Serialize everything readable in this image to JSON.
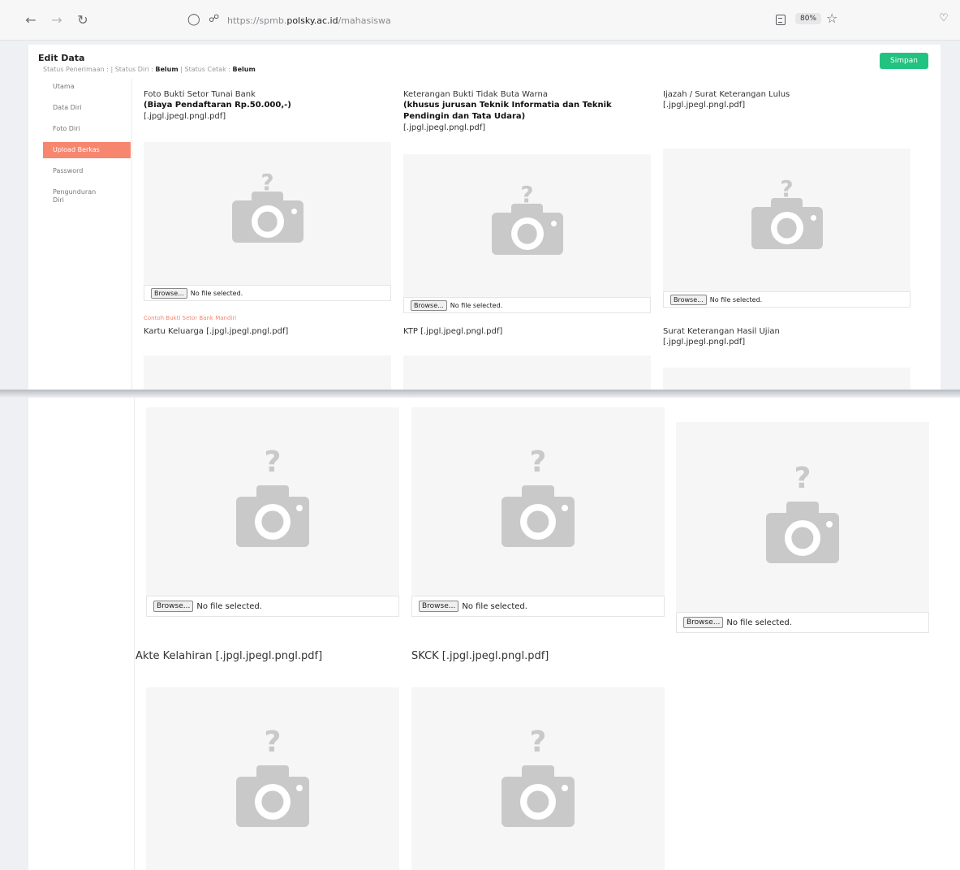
{
  "browser": {
    "url_prefix": "https://spmb.",
    "url_domain": "polsky.ac.id",
    "url_path": "/mahasiswa",
    "zoom": "80%"
  },
  "header": {
    "title": "Edit Data",
    "status_prefix": "Status Penerimaan : | Status Diri : ",
    "status_diri": "Belum",
    "status_cetak_label": " | Status Cetak : ",
    "status_cetak": "Belum",
    "save_label": "Simpan"
  },
  "sidebar": {
    "items": [
      {
        "label": "Utama"
      },
      {
        "label": "Data Diri"
      },
      {
        "label": "Foto Diri"
      },
      {
        "label": "Upload Berkas"
      },
      {
        "label": "Password"
      },
      {
        "label": "Pengunduran Diri"
      }
    ]
  },
  "uploads": {
    "setor": {
      "label": "Foto Bukti Setor Tunai Bank",
      "bold": "(Biaya Pendaftaran Rp.50.000,-)",
      "ext": "[.jpgl.jpegl.pngl.pdf]",
      "browse": "Browse...",
      "status": "No file selected.",
      "contoh": "Contoh Bukti Setor Bank Mandiri"
    },
    "buta_warna": {
      "label": "Keterangan Bukti Tidak Buta Warna",
      "bold": "(khusus jurusan Teknik Informatia dan Teknik Pendingin dan Tata Udara)",
      "ext": "[.jpgl.jpegl.pngl.pdf]",
      "browse": "Browse...",
      "status": "No file selected."
    },
    "ijazah": {
      "label": "Ijazah / Surat Keterangan Lulus",
      "ext": "[.jpgl.jpegl.pngl.pdf]",
      "browse": "Browse...",
      "status": "No file selected."
    },
    "kk": {
      "label": "Kartu Keluarga [.jpgl.jpegl.pngl.pdf]",
      "browse": "Browse...",
      "status": "No file selected."
    },
    "ktp": {
      "label": "KTP [.jpgl.jpegl.pngl.pdf]",
      "browse": "Browse...",
      "status": "No file selected."
    },
    "shu": {
      "label": "Surat Keterangan Hasil Ujian",
      "ext": "[.jpgl.jpegl.pngl.pdf]",
      "browse": "Browse...",
      "status": "No file selected."
    },
    "akte": {
      "label": "Akte Kelahiran [.jpgl.jpegl.pngl.pdf]"
    },
    "skck": {
      "label": "SKCK [.jpgl.jpegl.pngl.pdf]"
    }
  }
}
